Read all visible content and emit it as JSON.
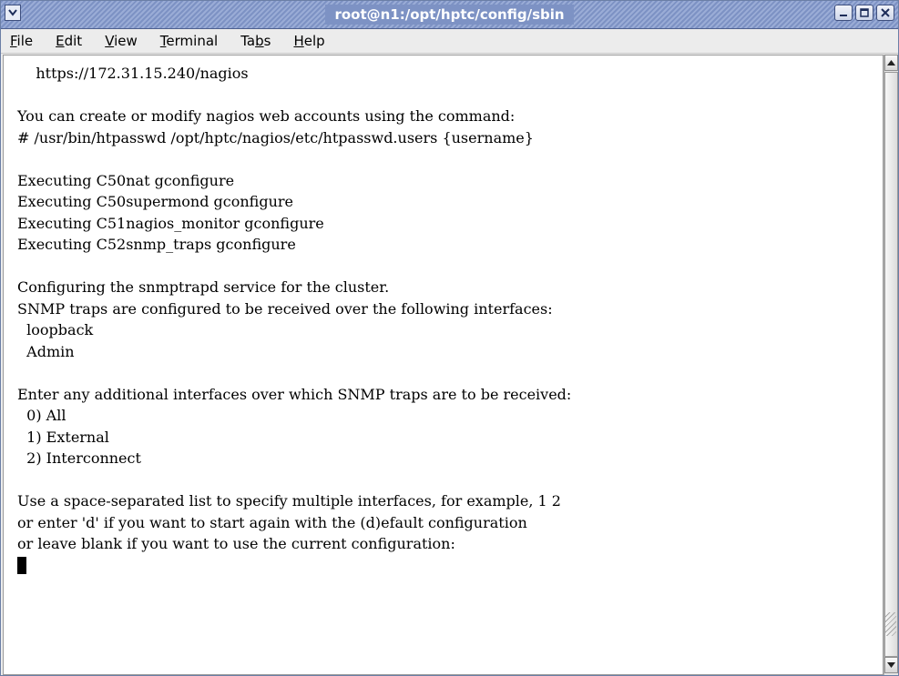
{
  "window": {
    "title": "root@n1:/opt/hptc/config/sbin",
    "icons": {
      "window_menu": "chevron-down-icon",
      "minimize": "minimize-icon",
      "maximize": "maximize-icon",
      "close": "close-icon"
    }
  },
  "menubar": {
    "items": [
      {
        "pre": "",
        "mn": "F",
        "post": "ile"
      },
      {
        "pre": "",
        "mn": "E",
        "post": "dit"
      },
      {
        "pre": "",
        "mn": "V",
        "post": "iew"
      },
      {
        "pre": "",
        "mn": "T",
        "post": "erminal"
      },
      {
        "pre": "Ta",
        "mn": "b",
        "post": "s"
      },
      {
        "pre": "",
        "mn": "H",
        "post": "elp"
      }
    ]
  },
  "terminal": {
    "lines": [
      "    https://172.31.15.240/nagios",
      "",
      "You can create or modify nagios web accounts using the command:",
      "# /usr/bin/htpasswd /opt/hptc/nagios/etc/htpasswd.users {username}",
      "",
      "Executing C50nat gconfigure",
      "Executing C50supermond gconfigure",
      "Executing C51nagios_monitor gconfigure",
      "Executing C52snmp_traps gconfigure",
      "",
      "Configuring the snmptrapd service for the cluster.",
      "SNMP traps are configured to be received over the following interfaces:",
      "  loopback",
      "  Admin",
      "",
      "Enter any additional interfaces over which SNMP traps are to be received:",
      "  0) All",
      "  1) External",
      "  2) Interconnect",
      "",
      "Use a space-separated list to specify multiple interfaces, for example, 1 2",
      "or enter 'd' if you want to start again with the (d)efault configuration",
      "or leave blank if you want to use the current configuration:"
    ]
  },
  "scrollbar": {
    "up_icon": "arrow-up-icon",
    "down_icon": "arrow-down-icon",
    "position": 1.0
  }
}
